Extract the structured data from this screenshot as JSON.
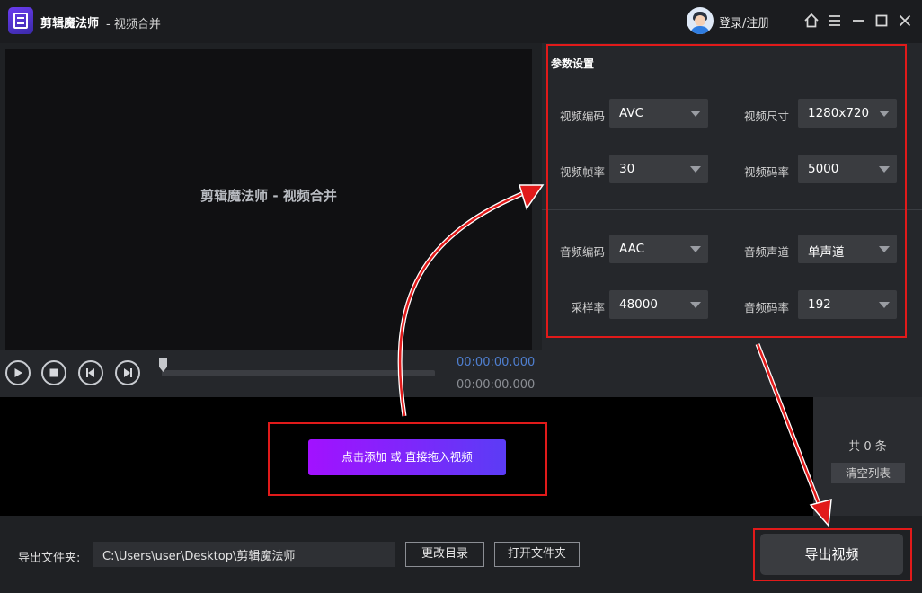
{
  "window": {
    "app_name": "剪辑魔法师",
    "subtitle": "- 视频合并",
    "login_label": "登录/注册",
    "controls": [
      "home-icon",
      "menu-icon",
      "minimize-icon",
      "maximize-icon",
      "close-icon"
    ]
  },
  "preview": {
    "placeholder": "剪辑魔法师 - 视频合并"
  },
  "params": {
    "title": "参数设置",
    "video": [
      {
        "label": "视频编码",
        "value": "AVC"
      },
      {
        "label": "视频尺寸",
        "value": "1280x720"
      },
      {
        "label": "视频帧率",
        "value": "30"
      },
      {
        "label": "视频码率",
        "value": "5000"
      }
    ],
    "audio": [
      {
        "label": "音频编码",
        "value": "AAC"
      },
      {
        "label": "音频声道",
        "value": "单声道"
      },
      {
        "label": "采样率",
        "value": "48000"
      },
      {
        "label": "音频码率",
        "value": "192"
      }
    ]
  },
  "player": {
    "current_time": "00:00:00.000",
    "total_time": "00:00:00.000",
    "progress": 0,
    "buttons": [
      "play-icon",
      "stop-icon",
      "previous-frame-icon",
      "next-frame-icon"
    ]
  },
  "filelist": {
    "add_button": "点击添加 或 直接拖入视频",
    "count_text": "共 0 条",
    "clear_button": "清空列表"
  },
  "bottom": {
    "output_label": "导出文件夹:",
    "output_path": "C:\\Users\\user\\Desktop\\剪辑魔法师",
    "change_dir_button": "更改目录",
    "open_folder_button": "打开文件夹",
    "export_button": "导出视频"
  },
  "colors": {
    "annotation_red": "#e11a1a",
    "accent_gradient_start": "#a211ff",
    "accent_gradient_end": "#5b3cf6",
    "time_blue": "#4f7fd0"
  }
}
